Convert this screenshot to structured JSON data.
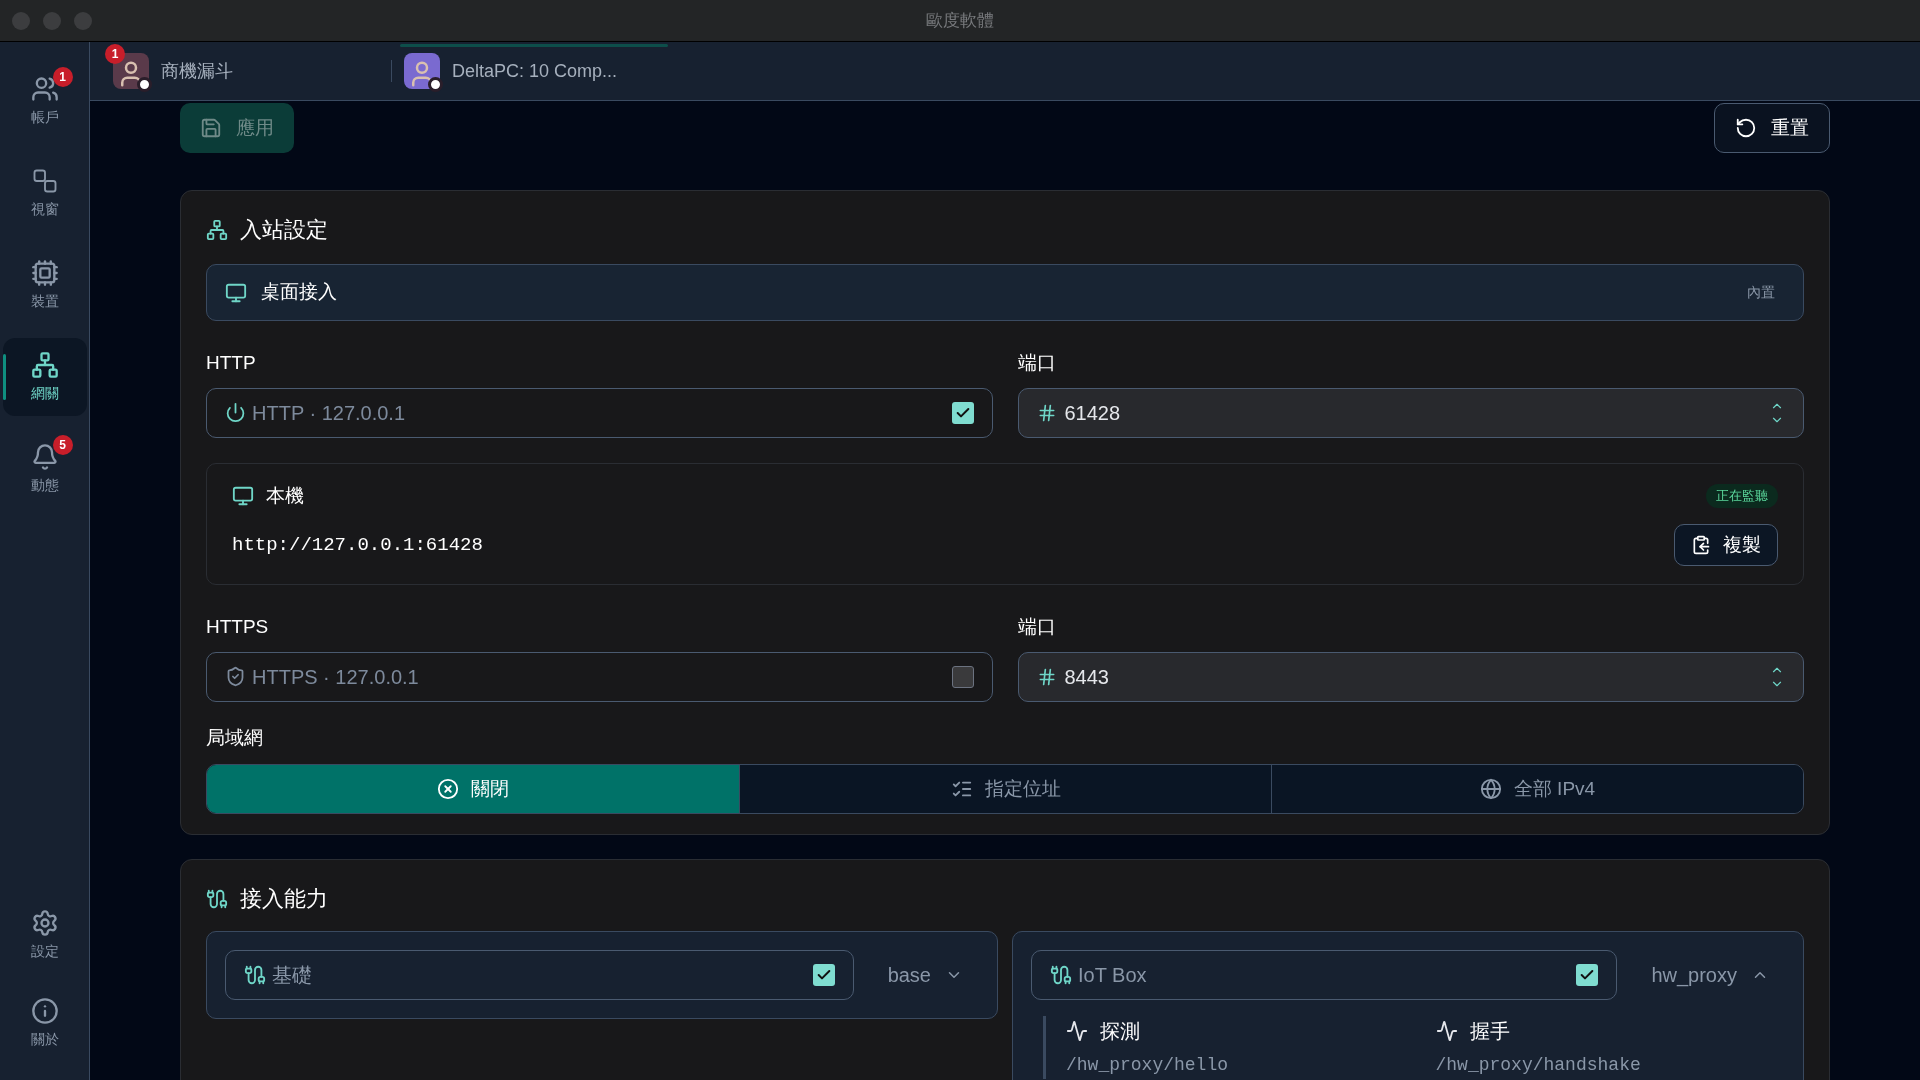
{
  "window": {
    "title": "歐度軟體"
  },
  "sidebar": {
    "items": [
      {
        "label": "帳戶",
        "selected": false,
        "badge": "1"
      },
      {
        "label": "視窗",
        "selected": false
      },
      {
        "label": "裝置",
        "selected": false
      },
      {
        "label": "網關",
        "selected": true
      },
      {
        "label": "動態",
        "selected": false,
        "badge": "5"
      }
    ],
    "bottom_items": [
      {
        "label": "設定"
      },
      {
        "label": "關於"
      }
    ]
  },
  "tabs": [
    {
      "label": "商機漏斗",
      "selected": false,
      "badge": "1"
    },
    {
      "label": "DeltaPC: 10 Comp...",
      "selected": true
    }
  ],
  "toolbar": {
    "apply": "應用",
    "reset": "重置"
  },
  "inbound": {
    "title": "入站設定",
    "mode": {
      "label": "桌面接入",
      "tag": "內置"
    },
    "http": {
      "label": "HTTP",
      "value": "HTTP · 127.0.0.1",
      "checked": true,
      "port_label": "端口",
      "port": "61428"
    },
    "local": {
      "title": "本機",
      "status": "正在監聽",
      "url": "http://127.0.0.1:61428",
      "copy": "複製"
    },
    "https": {
      "label": "HTTPS",
      "value": "HTTPS · 127.0.0.1",
      "checked": false,
      "port_label": "端口",
      "port": "8443"
    },
    "lan": {
      "label": "局域網",
      "options": [
        {
          "label": "關閉",
          "selected": true
        },
        {
          "label": "指定位址",
          "selected": false
        },
        {
          "label": "全部 IPv4",
          "selected": false
        }
      ]
    }
  },
  "capabilities": {
    "title": "接入能力",
    "items": [
      {
        "label": "基礎",
        "checked": true,
        "value": "base",
        "expanded": false
      },
      {
        "label": "IoT Box",
        "checked": true,
        "value": "hw_proxy",
        "expanded": true,
        "children": [
          {
            "label": "探測",
            "path": "/hw_proxy/hello"
          },
          {
            "label": "握手",
            "path": "/hw_proxy/handshake"
          }
        ]
      }
    ]
  }
}
